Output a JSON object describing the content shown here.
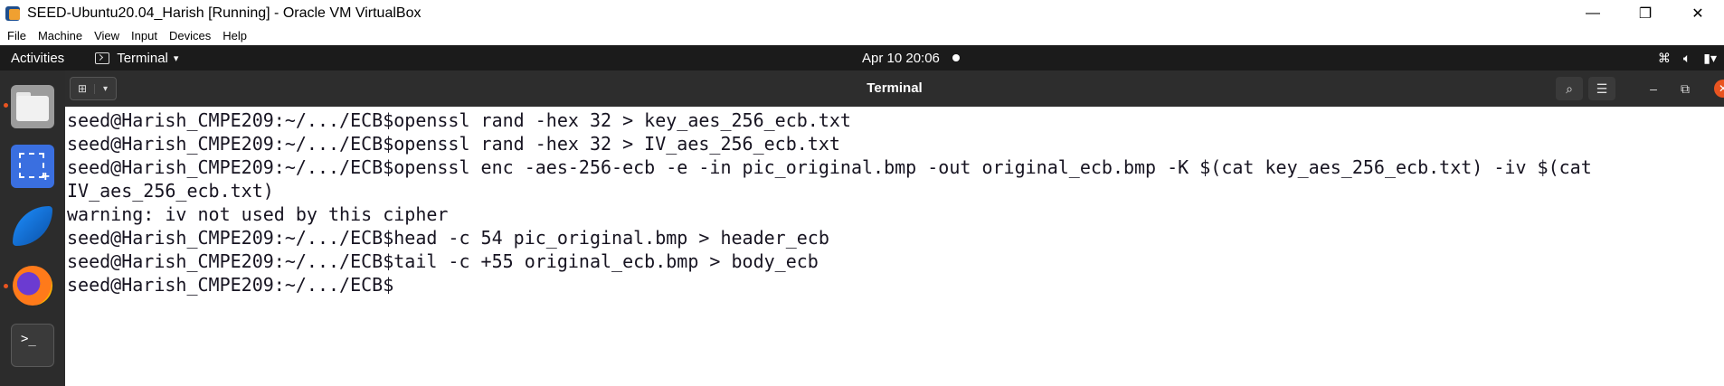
{
  "host_window": {
    "title": "SEED-Ubuntu20.04_Harish [Running] - Oracle VM VirtualBox",
    "controls": {
      "minimize": "—",
      "restore": "❐",
      "close": "✕"
    }
  },
  "host_menu": [
    "File",
    "Machine",
    "View",
    "Input",
    "Devices",
    "Help"
  ],
  "gnome_bar": {
    "activities": "Activities",
    "app_menu": "Terminal",
    "caret": "▾",
    "clock": "Apr 10  20:06",
    "tray_icons": [
      "network-icon",
      "volume-icon",
      "power-icon"
    ]
  },
  "dock": {
    "items": [
      "files-icon",
      "screenshot-icon",
      "wireshark-icon",
      "firefox-icon",
      "terminal-icon"
    ],
    "terminal_glyph": ">_"
  },
  "terminal": {
    "title": "Terminal",
    "lines": [
      "seed@Harish_CMPE209:~/.../ECB$openssl rand -hex 32 > key_aes_256_ecb.txt",
      "seed@Harish_CMPE209:~/.../ECB$openssl rand -hex 32 > IV_aes_256_ecb.txt",
      "seed@Harish_CMPE209:~/.../ECB$openssl enc -aes-256-ecb -e -in pic_original.bmp -out original_ecb.bmp -K $(cat key_aes_256_ecb.txt) -iv $(cat",
      "IV_aes_256_ecb.txt)",
      "warning: iv not used by this cipher",
      "seed@Harish_CMPE209:~/.../ECB$head -c 54 pic_original.bmp > header_ecb",
      "seed@Harish_CMPE209:~/.../ECB$tail -c +55 original_ecb.bmp > body_ecb",
      "seed@Harish_CMPE209:~/.../ECB$"
    ]
  },
  "colors": {
    "gnome_bar": "#1b1b1b",
    "dock": "#2c2c2c",
    "term_header": "#2d2d2d",
    "accent": "#e95420"
  }
}
